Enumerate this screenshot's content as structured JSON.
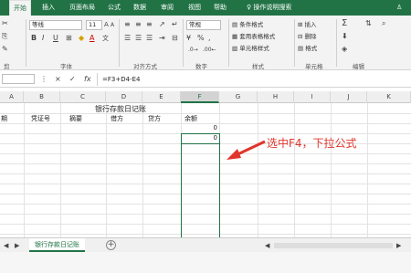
{
  "tabs": [
    "开始",
    "插入",
    "页面布局",
    "公式",
    "数据",
    "审阅",
    "视图",
    "帮助"
  ],
  "tell_me": "操作说明搜索",
  "ribbon": {
    "font_name": "等线",
    "font_size": "11",
    "bold": "B",
    "italic": "I",
    "underline": "U",
    "font_color_letter": "A",
    "wen": "文",
    "number_format": "常规",
    "percent": "%",
    "comma": ",",
    "cond_format": "条件格式",
    "table_format": "套用表格格式",
    "cell_styles": "单元格样式",
    "insert": "插入",
    "delete": "删除",
    "format": "格式",
    "sum": "Σ",
    "groups": {
      "clipboard": "剪",
      "font": "字体",
      "alignment": "对齐方式",
      "number": "数字",
      "styles": "样式",
      "cells": "单元格",
      "editing": "编辑"
    }
  },
  "formula_bar": {
    "cancel": "×",
    "confirm": "✓",
    "fx": "fx",
    "formula": "=F3+D4-E4"
  },
  "columns": [
    "A",
    "B",
    "C",
    "D",
    "E",
    "F",
    "G",
    "H",
    "I",
    "J",
    "K"
  ],
  "sheet": {
    "title": "银行存款日记账",
    "headers": [
      "期",
      "凭证号",
      "摘要",
      "借方",
      "贷方",
      "余额"
    ],
    "f3": "0",
    "f4": "0"
  },
  "annotation": "选中F4，下拉公式",
  "sheet_tab": "银行存款日记账",
  "add_sheet": "+",
  "colors": {
    "excel_green": "#217346",
    "annotation_red": "#e0352b"
  }
}
